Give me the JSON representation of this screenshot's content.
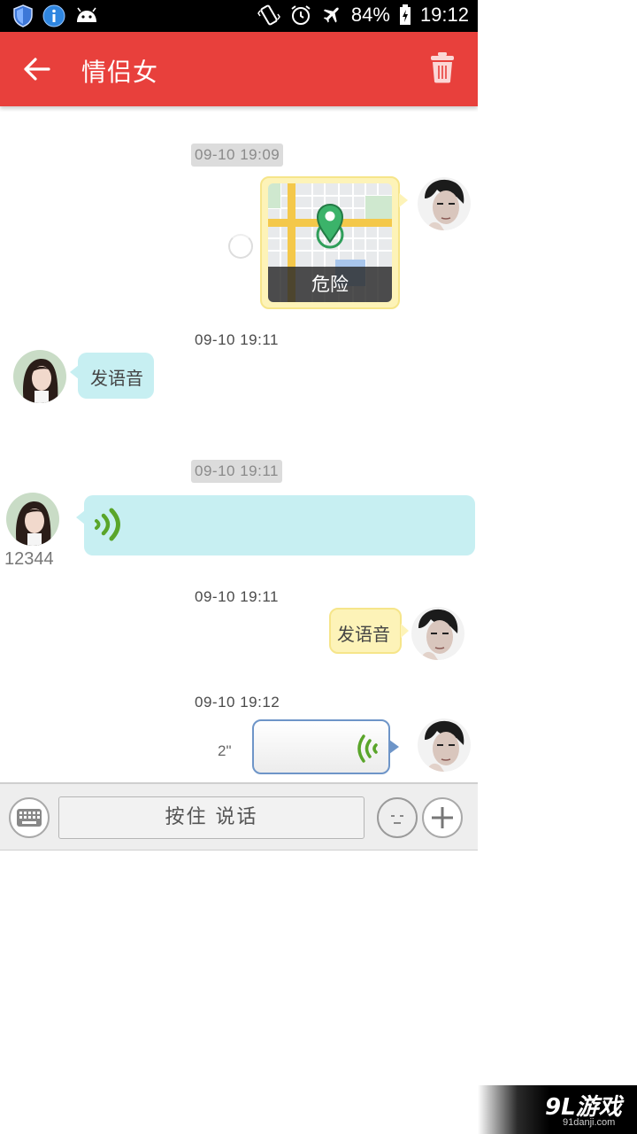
{
  "status_bar": {
    "battery": "84%",
    "time": "19:12"
  },
  "header": {
    "title": "情侣女"
  },
  "messages": {
    "t1": "09-10 19:09",
    "map_label": "危险",
    "t2": "09-10 19:11",
    "m2_text": "发语音",
    "t3": "09-10 19:11",
    "sender_name": "12344",
    "t4": "09-10 19:11",
    "m4_text": "发语音",
    "t5": "09-10 19:12",
    "voice_duration": "2\""
  },
  "input": {
    "hold_to_talk": "按住 说话"
  },
  "watermark": {
    "brand": "9L游戏",
    "site": "91danji.com"
  },
  "colors": {
    "appbar": "#e8403c",
    "bubble_self": "#fdf3b8",
    "bubble_other": "#c7eff2",
    "voice_icon": "#5aa52a"
  }
}
